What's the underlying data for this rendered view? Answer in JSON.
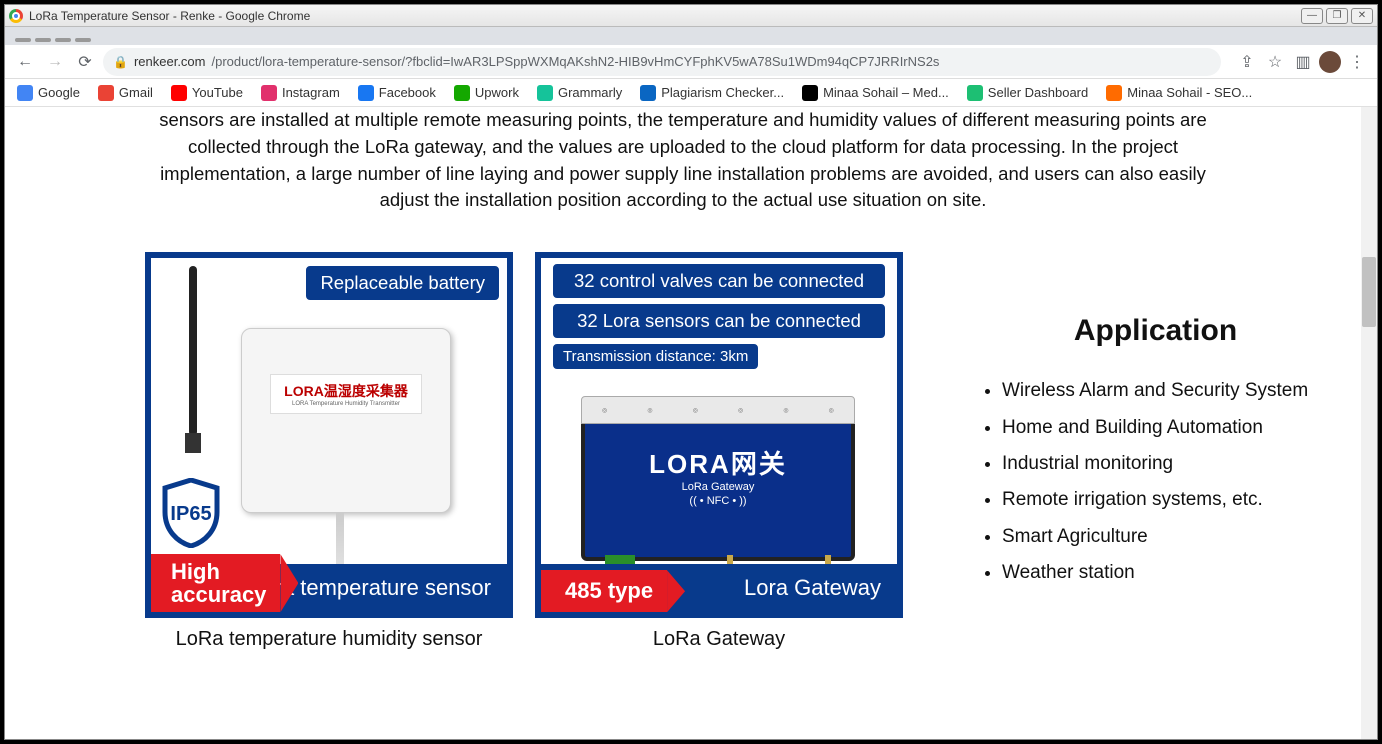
{
  "window": {
    "title": "LoRa Temperature Sensor - Renke - Google Chrome"
  },
  "nav": {
    "url_domain": "renkeer.com",
    "url_path": "/product/lora-temperature-sensor/?fbclid=IwAR3LPSppWXMqAKshN2-HIB9vHmCYFphKV5wA78Su1WDm94qCP7JRRIrNS2s"
  },
  "bookmarks": [
    {
      "label": "Google",
      "color": "#4285f4"
    },
    {
      "label": "Gmail",
      "color": "#ea4335"
    },
    {
      "label": "YouTube",
      "color": "#ff0000"
    },
    {
      "label": "Instagram",
      "color": "#e1306c"
    },
    {
      "label": "Facebook",
      "color": "#1877f2"
    },
    {
      "label": "Upwork",
      "color": "#14a800"
    },
    {
      "label": "Grammarly",
      "color": "#15c39a"
    },
    {
      "label": "Plagiarism Checker...",
      "color": "#0a66c2"
    },
    {
      "label": "Minaa Sohail – Med...",
      "color": "#000"
    },
    {
      "label": "Seller Dashboard",
      "color": "#1dbf73"
    },
    {
      "label": "Minaa Sohail - SEO...",
      "color": "#ff6b00"
    }
  ],
  "page": {
    "intro": "sensors are installed at multiple remote measuring points, the temperature and humidity values of different measuring points are collected through the LoRa gateway, and the values are uploaded to the cloud platform for data processing. In the project implementation, a large number of line laying and power supply line installation problems are avoided, and users can also easily adjust the installation position according to the actual use situation on site.",
    "products": [
      {
        "badge_top": "Replaceable battery",
        "ip_label": "IP65",
        "device_label_zh": "LORA温湿度采集器",
        "device_label_en": "LORA Temperature Humidity Transmitter",
        "corner_red": "High accuracy",
        "footer": "Lora temperature sensor",
        "caption": "LoRa temperature humidity sensor"
      },
      {
        "badge_line1": "32 control valves can be connected",
        "badge_line2": "32 Lora sensors can be connected",
        "badge_line3": "Transmission distance: 3km",
        "gw_title": "LORA网关",
        "gw_sub": "LoRa Gateway",
        "gw_nfc": "(( • NFC • ))",
        "corner_red": "485 type",
        "footer": "Lora Gateway",
        "caption": "LoRa Gateway"
      }
    ],
    "application": {
      "title": "Application",
      "items": [
        "Wireless Alarm and Security System",
        "Home and Building Automation",
        "Industrial monitoring",
        "Remote irrigation systems, etc.",
        "Smart Agriculture",
        "Weather station"
      ]
    }
  }
}
